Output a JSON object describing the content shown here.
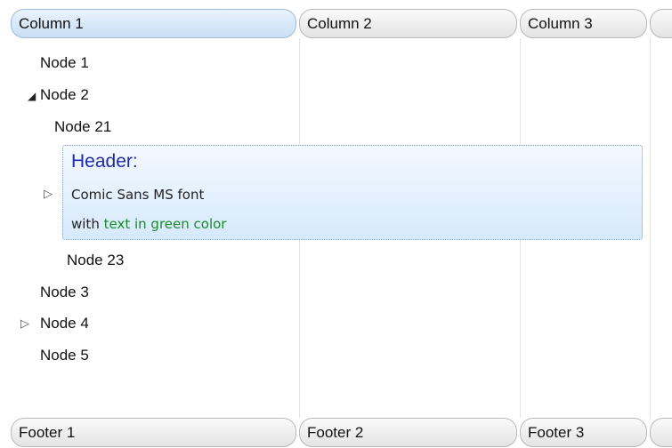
{
  "columns": [
    {
      "label": "Column 1"
    },
    {
      "label": "Column 2"
    },
    {
      "label": "Column 3"
    }
  ],
  "footers": [
    {
      "label": "Footer 1"
    },
    {
      "label": "Footer 2"
    },
    {
      "label": "Footer 3"
    }
  ],
  "tree": {
    "node1": "Node 1",
    "node2": "Node 2",
    "node21": "Node 21",
    "selected": {
      "header": "Header:",
      "line1": "Comic Sans MS font",
      "line2_prefix": "with",
      "line2_green": "text in green color"
    },
    "node23": "Node 23",
    "node3": "Node 3",
    "node4": "Node 4",
    "node5": "Node 5"
  },
  "glyphs": {
    "expanded": "◢",
    "collapsed": "▷"
  },
  "colors": {
    "header_text": "#1f2aa8",
    "green_text": "#1a8a2a",
    "selection_bg": "#d6e9fb"
  }
}
